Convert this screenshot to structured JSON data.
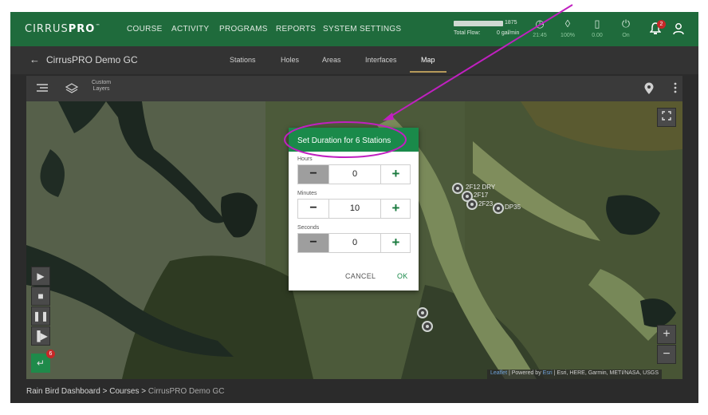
{
  "app": {
    "logo_light": "CIRRUS",
    "logo_bold": "PRO",
    "logo_tm": "™",
    "nav": [
      "COURSE",
      "ACTIVITY",
      "PROGRAMS",
      "REPORTS",
      "SYSTEM SETTINGS"
    ],
    "flow": {
      "max": "1875",
      "label": "Total Flow:",
      "value": "0 gal/min"
    },
    "stats": [
      {
        "icon": "clock-icon",
        "glyph": "◷",
        "value": "21:45"
      },
      {
        "icon": "water-drop-icon",
        "glyph": "◊",
        "value": "100%"
      },
      {
        "icon": "battery-icon",
        "glyph": "▯",
        "value": "0.00"
      },
      {
        "icon": "power-icon",
        "glyph": "⏻",
        "value": "On"
      }
    ],
    "notifications_count": "2"
  },
  "subnav": {
    "site": "CirrusPRO Demo GC",
    "tabs": [
      "Stations",
      "Holes",
      "Areas",
      "Interfaces",
      "Map"
    ],
    "active_tab": "Map"
  },
  "toolbar": {
    "custom_layers_line1": "Custom",
    "custom_layers_line2": "Layers"
  },
  "map": {
    "station_labels": [
      "2F12 DRY",
      "2F17",
      "2F23",
      "DP35"
    ],
    "queue_count": "6",
    "attribution": {
      "leaflet": "Leaflet",
      "powered": " | Powered by ",
      "esri": "Esri",
      "rest": " | Esri, HERE, Garmin, METI/NASA, USGS"
    }
  },
  "dialog": {
    "title": "Set Duration for 6 Stations",
    "fields": [
      {
        "label": "Hours",
        "value": "0"
      },
      {
        "label": "Minutes",
        "value": "10"
      },
      {
        "label": "Seconds",
        "value": "0"
      }
    ],
    "minus": "−",
    "plus": "+",
    "cancel": "CANCEL",
    "ok": "OK"
  },
  "breadcrumb": {
    "items": [
      "Rain Bird Dashboard",
      "Courses"
    ],
    "separator": ">",
    "current": "CirrusPRO Demo GC"
  },
  "colors": {
    "brand_green": "#1f6b3c",
    "dialog_green": "#1a8a4a",
    "annotation_magenta": "#c020c0"
  }
}
